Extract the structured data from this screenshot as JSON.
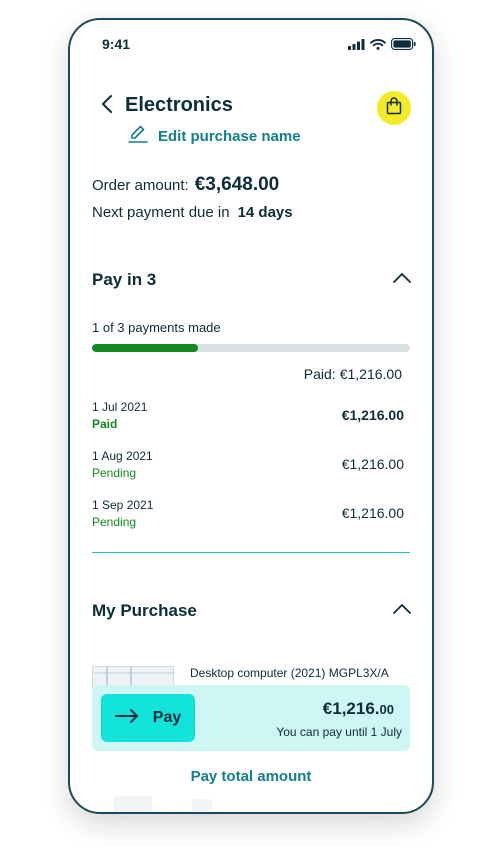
{
  "status_bar": {
    "time": "9:41"
  },
  "header": {
    "title": "Electronics",
    "edit_label": "Edit purchase name"
  },
  "order": {
    "amount_label": "Order amount:",
    "amount_value": "€3,648.00",
    "next_label": "Next payment due in",
    "next_value": "14 days"
  },
  "pay_in_3": {
    "title": "Pay in 3",
    "progress_label": "1 of 3 payments made",
    "progress_fraction": 0.3333,
    "paid_label": "Paid:",
    "paid_value": "€1,216.00",
    "payments": [
      {
        "date": "1 Jul 2021",
        "status": "Paid",
        "amount": "€1,216.00"
      },
      {
        "date": "1 Aug 2021",
        "status": "Pending",
        "amount": "€1,216.00"
      },
      {
        "date": "1 Sep 2021",
        "status": "Pending",
        "amount": "€1,216.00"
      }
    ]
  },
  "my_purchase": {
    "title": "My Purchase",
    "item_name": "Desktop computer (2021) MGPL3X/A"
  },
  "pay_card": {
    "button_label": "Pay",
    "amount_main": "€1,216.",
    "amount_cents": "00",
    "note": "You can pay until 1 July"
  },
  "pay_total": {
    "label": "Pay total amount"
  },
  "colors": {
    "accent": "#12e3da",
    "link": "#12808a",
    "paid_green": "#14891f",
    "bag_yellow": "#f4ea2a",
    "card_bg": "#cff6f4"
  },
  "icons": [
    "signal-icon",
    "wifi-icon",
    "battery-icon",
    "back-arrow-icon",
    "shopping-bag-icon",
    "pencil-icon",
    "chevron-up-icon",
    "arrow-right-icon"
  ]
}
